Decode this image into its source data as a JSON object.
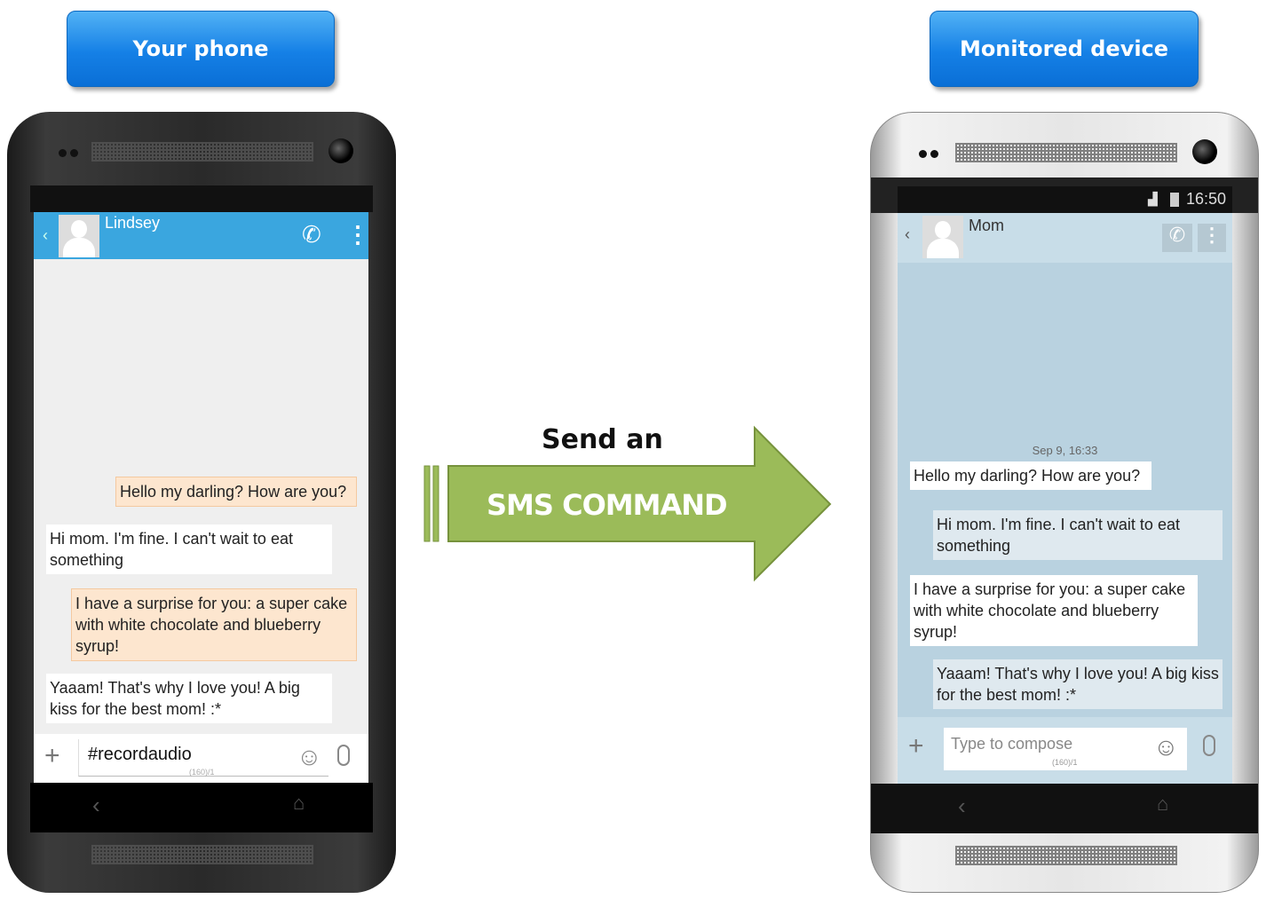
{
  "labels": {
    "left": "Your phone",
    "right": "Monitored device"
  },
  "arrow": {
    "line1": "Send an",
    "line2": "SMS COMMAND",
    "color": "#9bbb59"
  },
  "left_phone": {
    "contact": "Lindsey",
    "messages": [
      {
        "dir": "out",
        "text": "Hello my darling? How are you?"
      },
      {
        "dir": "in",
        "text": "Hi mom. I'm fine. I can't wait to eat something"
      },
      {
        "dir": "out",
        "text": "I have a surprise for you: a super cake with white chocolate and blueberry syrup!"
      },
      {
        "dir": "in",
        "text": "Yaaam! That's why I love you! A big kiss for the best mom! :*"
      }
    ],
    "compose_value": "#recordaudio",
    "counter": "(160)/1",
    "header_color": "#3aa6df"
  },
  "right_phone": {
    "time": "16:50",
    "contact": "Mom",
    "date": "Sep 9, 16:33",
    "messages": [
      {
        "dir": "in",
        "text": "Hello my darling? How are you?"
      },
      {
        "dir": "out",
        "text": "Hi mom. I'm fine. I can't wait to eat something"
      },
      {
        "dir": "in",
        "text": "I have a surprise for you: a super cake with white chocolate and blueberry syrup!"
      },
      {
        "dir": "out",
        "text": "Yaaam! That's why I love you! A big kiss for the best mom! :*"
      }
    ],
    "compose_placeholder": "Type to compose",
    "counter": "(160)/1"
  }
}
